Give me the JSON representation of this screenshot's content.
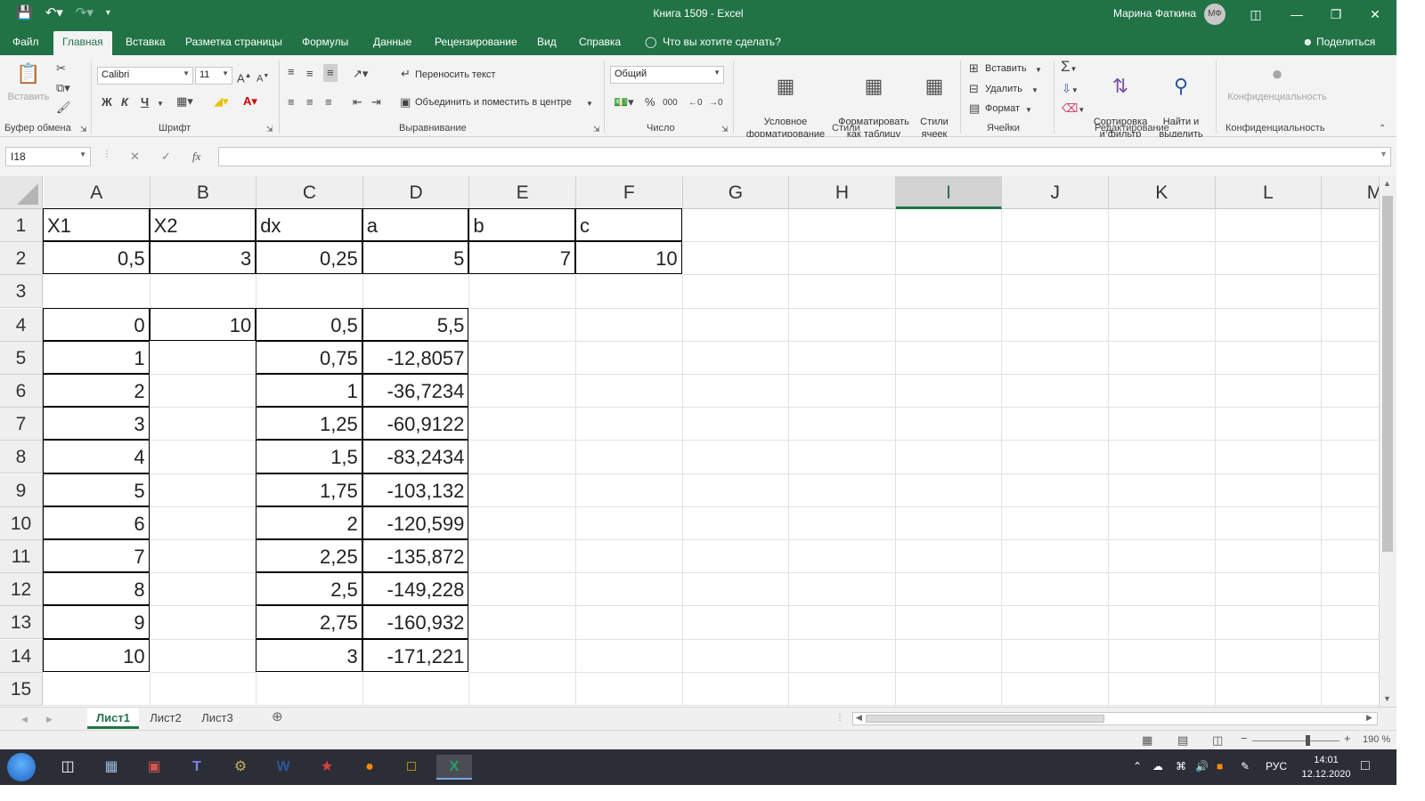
{
  "titlebar": {
    "title": "Книга 1509  -  Excel",
    "user": "Марина Фаткина",
    "avatar": "МФ",
    "icons": [
      "save-icon",
      "undo-icon",
      "redo-icon",
      "customize-icon"
    ]
  },
  "tabs": [
    "Файл",
    "Главная",
    "Вставка",
    "Разметка страницы",
    "Формулы",
    "Данные",
    "Рецензирование",
    "Вид",
    "Справка"
  ],
  "tell_me": "Что вы хотите сделать?",
  "share": "Поделиться",
  "ribbon": {
    "clipboard": {
      "paste": "Вставить",
      "label": "Буфер обмена"
    },
    "font": {
      "name": "Calibri",
      "size": "11",
      "label": "Шрифт",
      "bold": "Ж",
      "italic": "К",
      "underline": "Ч"
    },
    "alignment": {
      "wrap": "Переносить текст",
      "merge": "Объединить и поместить в центре",
      "label": "Выравнивание"
    },
    "number": {
      "format": "Общий",
      "label": "Число"
    },
    "styles": {
      "conditional": "Условное\nформатирование",
      "as_table": "Форматировать\nкак таблицу",
      "cell_styles": "Стили\nячеек",
      "label": "Стили"
    },
    "cells": {
      "insert": "Вставить",
      "delete": "Удалить",
      "format": "Формат",
      "label": "Ячейки"
    },
    "editing": {
      "sort": "Сортировка\nи фильтр",
      "find": "Найти и\nвыделить",
      "label": "Редактирование"
    },
    "sensitivity": {
      "button": "Конфиденциальность",
      "label": "Конфиденциальность"
    }
  },
  "formula_bar": {
    "name_box": "I18",
    "formula": ""
  },
  "columns": [
    "A",
    "B",
    "C",
    "D",
    "E",
    "F",
    "G",
    "H",
    "I",
    "J",
    "K",
    "L",
    "M"
  ],
  "selected_column": "I",
  "rows": [
    "1",
    "2",
    "3",
    "4",
    "5",
    "6",
    "7",
    "8",
    "9",
    "10",
    "11",
    "12",
    "13",
    "14",
    "15"
  ],
  "cells": {
    "A1": "X1",
    "B1": "X2",
    "C1": "dx",
    "D1": "a",
    "E1": "b",
    "F1": "c",
    "A2": "0,5",
    "B2": "3",
    "C2": "0,25",
    "D2": "5",
    "E2": "7",
    "F2": "10",
    "A4": "0",
    "B4": "10",
    "C4": "0,5",
    "D4": "5,5",
    "A5": "1",
    "C5": "0,75",
    "D5": "-12,8057",
    "A6": "2",
    "C6": "1",
    "D6": "-36,7234",
    "A7": "3",
    "C7": "1,25",
    "D7": "-60,9122",
    "A8": "4",
    "C8": "1,5",
    "D8": "-83,2434",
    "A9": "5",
    "C9": "1,75",
    "D9": "-103,132",
    "A10": "6",
    "C10": "2",
    "D10": "-120,599",
    "A11": "7",
    "C11": "2,25",
    "D11": "-135,872",
    "A12": "8",
    "C12": "2,5",
    "D12": "-149,228",
    "A13": "9",
    "C13": "2,75",
    "D13": "-160,932",
    "A14": "10",
    "C14": "3",
    "D14": "-171,221"
  },
  "sheets": [
    "Лист1",
    "Лист2",
    "Лист3"
  ],
  "active_sheet": "Лист1",
  "status": {
    "zoom": "190 %"
  },
  "taskbar": {
    "language": "РУС",
    "time": "14:01",
    "date": "12.12.2020",
    "apps": [
      "start-icon",
      "task-view-icon",
      "calculator-icon",
      "winrar-icon",
      "teams-icon",
      "ccleaner-icon",
      "word-icon",
      "pin-app-icon",
      "firefox-icon",
      "explorer-icon",
      "excel-icon"
    ]
  },
  "colors": {
    "accent": "#217346",
    "taskbar": "#2b2e36"
  }
}
